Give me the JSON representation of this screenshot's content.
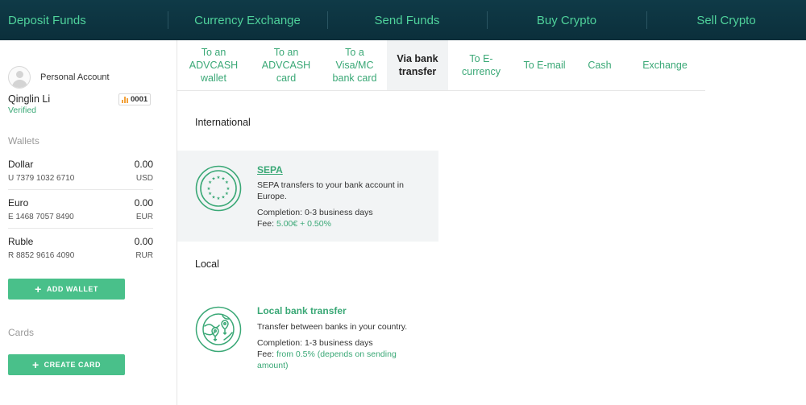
{
  "topnav": {
    "items": [
      "Deposit Funds",
      "Currency Exchange",
      "Send Funds",
      "Buy Crypto",
      "Sell Crypto"
    ]
  },
  "account": {
    "type": "Personal Account",
    "name": "Qinglin Li",
    "status": "Verified",
    "badge": "0001"
  },
  "wallets": {
    "title": "Wallets",
    "items": [
      {
        "name": "Dollar",
        "amount": "0.00",
        "number": "U 7379 1032 6710",
        "currency": "USD"
      },
      {
        "name": "Euro",
        "amount": "0.00",
        "number": "E 1468 7057 8490",
        "currency": "EUR"
      },
      {
        "name": "Ruble",
        "amount": "0.00",
        "number": "R 8852 9616 4090",
        "currency": "RUR"
      }
    ],
    "add_label": "ADD WALLET"
  },
  "cards": {
    "title": "Cards",
    "create_label": "CREATE CARD"
  },
  "tabs": [
    {
      "label": "To an ADVCASH wallet",
      "active": false
    },
    {
      "label": "To an ADVCASH card",
      "active": false
    },
    {
      "label": "To a Visa/MC bank card",
      "active": false
    },
    {
      "label": "Via bank transfer",
      "active": true
    },
    {
      "label": "To E-currency",
      "active": false
    },
    {
      "label": "To E-mail",
      "active": false
    },
    {
      "label": "Cash",
      "active": false
    },
    {
      "label": "Exchange",
      "active": false
    }
  ],
  "sections": {
    "international": "International",
    "local": "Local"
  },
  "methods": {
    "sepa": {
      "title": "SEPA",
      "description": "SEPA transfers to your bank account in Europe.",
      "completion": "Completion: 0-3 business days",
      "fee_label": "Fee:",
      "fee_value": "5.00€ + 0.50%",
      "icon": "eu-stars-icon"
    },
    "local": {
      "title": "Local bank transfer",
      "description": "Transfer between banks in your country.",
      "completion": "Completion: 1-3 business days",
      "fee_label": "Fee:",
      "fee_value": "from 0.5% (depends on sending amount)",
      "icon": "globe-location-icon"
    }
  },
  "colors": {
    "accent": "#3aa876",
    "button": "#49c08a",
    "nav_bg": "#0f3a47",
    "nav_text": "#4fd29b"
  }
}
